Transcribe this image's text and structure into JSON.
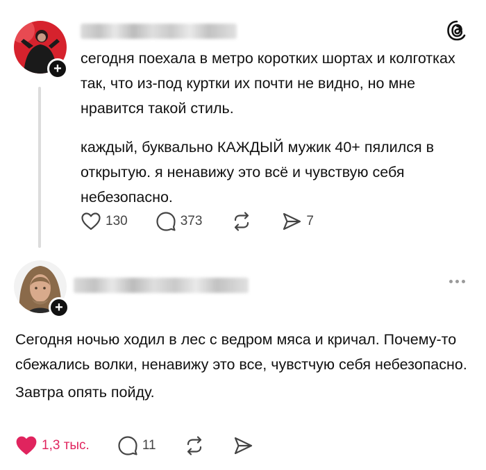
{
  "post1": {
    "paragraphs": [
      "сегодня поехала в метро коротких шортах и колготках так, что из-под куртки их почти не видно, но мне нравится такой стиль.",
      "каждый, буквально КАЖДЫЙ мужик 40+ пялился в открытую. я ненавижу это всё и чувствую себя небезопасно."
    ],
    "actions": {
      "likes": "130",
      "replies": "373",
      "shares": "7"
    },
    "follow_symbol": "+"
  },
  "post2": {
    "paragraphs": [
      "Сегодня ночью ходил в лес с ведром мяса и кричал. Почему-то сбежались волки, ненавижу это все, чувстчую себя небезопасно.",
      "Завтра опять пойду."
    ],
    "actions": {
      "likes": "1,3 тыс.",
      "replies": "11"
    },
    "follow_symbol": "+"
  },
  "colors": {
    "liked": "#e0245e",
    "icon": "#444444",
    "text": "#111111"
  },
  "icons": [
    "threads-logo-icon",
    "heart-icon",
    "comment-icon",
    "repost-icon",
    "share-icon",
    "more-options-icon",
    "plus-icon"
  ]
}
